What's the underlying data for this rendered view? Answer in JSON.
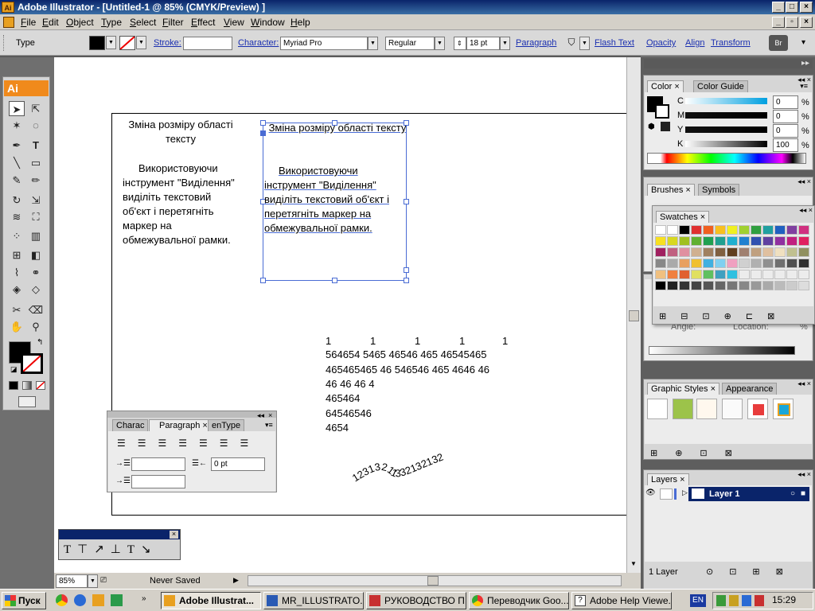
{
  "window": {
    "title": "Adobe Illustrator - [Untitled-1 @ 85% (CMYK/Preview) ]",
    "app_badge": "Ai"
  },
  "menu": [
    "File",
    "Edit",
    "Object",
    "Type",
    "Select",
    "Filter",
    "Effect",
    "View",
    "Window",
    "Help"
  ],
  "control": {
    "tool_label": "Type",
    "stroke_label": "Stroke:",
    "character_label": "Character:",
    "font_family": "Myriad Pro",
    "font_style": "Regular",
    "font_size": "18 pt",
    "paragraph_label": "Paragraph",
    "flash_text_label": "Flash Text",
    "opacity_label": "Opacity",
    "align_label": "Align",
    "transform_label": "Transform"
  },
  "toolbox": {
    "header": "Ai"
  },
  "canvas": {
    "text_plain": {
      "title": "Зміна розміру області тексту",
      "body": "Використовуючи інструмент \"Виділення\" виділіть текстовий об'єкт і перетягніть маркер на обмежувальної рамки."
    },
    "text_selected": {
      "title": "Зміна розміру області тексту",
      "body": "Використовуючи інструмент \"Виділення\" виділіть текстовий об'єкт і перетягніть маркер на обмежувальної рамки."
    },
    "number_lines": [
      "1",
      "1",
      "1",
      "1",
      "1"
    ],
    "number_rows": [
      "564654 5465 46546 465 46545465",
      "465465465 46 546546 465 4646 46",
      "46 46 46 4",
      "465464",
      "64546546",
      "4654"
    ],
    "path_text": "12313211332132132"
  },
  "paragraph_panel": {
    "tabs": [
      "Charac",
      "Paragraph",
      "enType"
    ],
    "space_value": "0 pt"
  },
  "status": {
    "zoom": "85%",
    "state": "Never Saved"
  },
  "dock": {
    "color": {
      "tabs": [
        "Color",
        "Color Guide"
      ],
      "rows": [
        {
          "label": "C",
          "value": "0"
        },
        {
          "label": "M",
          "value": "0"
        },
        {
          "label": "Y",
          "value": "0"
        },
        {
          "label": "K",
          "value": "100"
        }
      ],
      "unit": "%"
    },
    "brushes": {
      "tabs": [
        "Brushes",
        "Symbols"
      ]
    },
    "swatches": {
      "title": "Swatches"
    },
    "gradient": {
      "angle_label": "Angle:",
      "location_label": "Location:",
      "unit": "%"
    },
    "graphic_styles": {
      "tabs": [
        "Graphic Styles",
        "Appearance"
      ]
    },
    "layers": {
      "title": "Layers",
      "layer_name": "Layer 1",
      "footer": "1 Layer"
    }
  },
  "taskbar": {
    "start": "Пуск",
    "items": [
      "Adobe Illustrat...",
      "MR_ILLUSTRATO...",
      "РУКОВОДСТВО П...",
      "Переводчик Goo...",
      "Adobe Help Viewe..."
    ],
    "lang": "EN",
    "clock": "15:29"
  },
  "colors": {
    "accent": "#0a246a",
    "ai_orange": "#f08a1c",
    "selection": "#4a6cd4",
    "link": "#1a2fb0"
  }
}
